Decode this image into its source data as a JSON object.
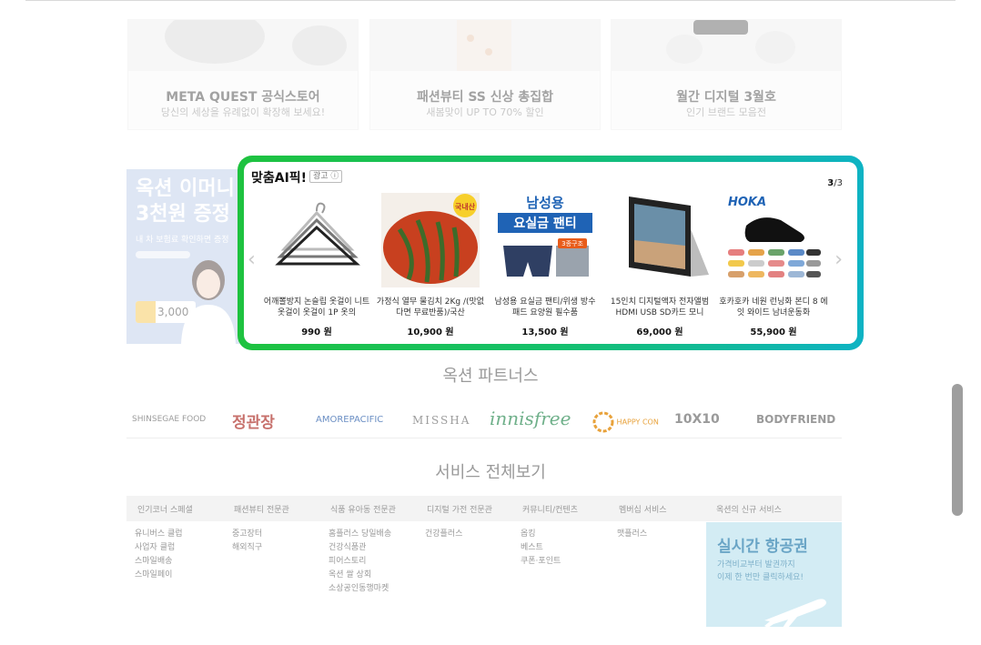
{
  "banners": [
    {
      "title": "META QUEST 공식스토어",
      "sub": "당신의 세상을 유례없이 확장해 보세요!"
    },
    {
      "title": "패션뷰티 SS 신상 총집합",
      "sub": "새봄맞이 UP TO 70% 할인"
    },
    {
      "title": "월간 디지털 3월호",
      "sub": "인기 브랜드 모음전"
    }
  ],
  "side_ad": {
    "line1": "옥션 이머니",
    "line2": "3천원 증정",
    "line3": "내 차 보험료 확인하면 증정",
    "coin": "3,000"
  },
  "ai_pick": {
    "title": "맞춤AI픽!",
    "ad_tag": "광고 ⓘ",
    "page_current": "3",
    "page_total": "/3",
    "arrow_left": "‹",
    "arrow_right": "›",
    "products": [
      {
        "name": "어깨뽈방지 논슬립 옷걸이 니트옷걸이 옷걸이 1P 옷의",
        "price": "990 원"
      },
      {
        "name": "가정식 열무 물김치 2Kg /(맛없다면 무료반품)/국산",
        "price": "10,900 원",
        "badge": "국내산"
      },
      {
        "name": "남성용 요실금 팬티/위생 방수 패드 요양원 필수품",
        "price": "13,500 원",
        "img_line1": "남성용",
        "img_line2": "요실금 팬티",
        "img_badge": "3종구조"
      },
      {
        "name": "15인치 디지털액자 전자앨범 HDMI USB SD카드 모니",
        "price": "69,000 원"
      },
      {
        "name": "호카호카 네원 런닝화 본디 8 에잇 와이드 남녀운동화",
        "price": "55,900 원",
        "brand": "HOKA"
      }
    ]
  },
  "partners": {
    "title": "옥션 파트너스",
    "items": [
      "SHINSEGAE FOOD",
      "정관장",
      "AMOREPACIFIC",
      "MISSHA",
      "innisfree",
      "HAPPY CON",
      "10X10",
      "BODYFRIEND"
    ]
  },
  "services": {
    "title": "서비스 전체보기",
    "headers": [
      "인기코너 스페셜",
      "패션뷰티 전문관",
      "식품 유아동 전문관",
      "디지털 가전 전문관",
      "커뮤니티/컨텐츠",
      "멤버십 서비스",
      "옥션의 신규 서비스"
    ],
    "columns": [
      [
        "유니버스 클럽",
        "사업자 클럽",
        "스마일배송",
        "스마일페이"
      ],
      [
        "중고장터",
        "해외직구"
      ],
      [
        "홈플러스 당일배송",
        "건강식품관",
        "피어스토리",
        "옥션 쌀 상회",
        "소상공인동행마켓"
      ],
      [
        "건강플러스"
      ],
      [
        "옵킹",
        "베스트",
        "쿠폰·포인트"
      ],
      [
        "맷플러스"
      ]
    ],
    "promo_title": "실시간 항공권",
    "promo_line1": "가격비교부터 발권까지",
    "promo_line2": "이제 한 번만 클릭하세요!"
  },
  "colors": {
    "ai_border_start": "#1ec23f",
    "ai_border_end": "#0eb3c4"
  }
}
